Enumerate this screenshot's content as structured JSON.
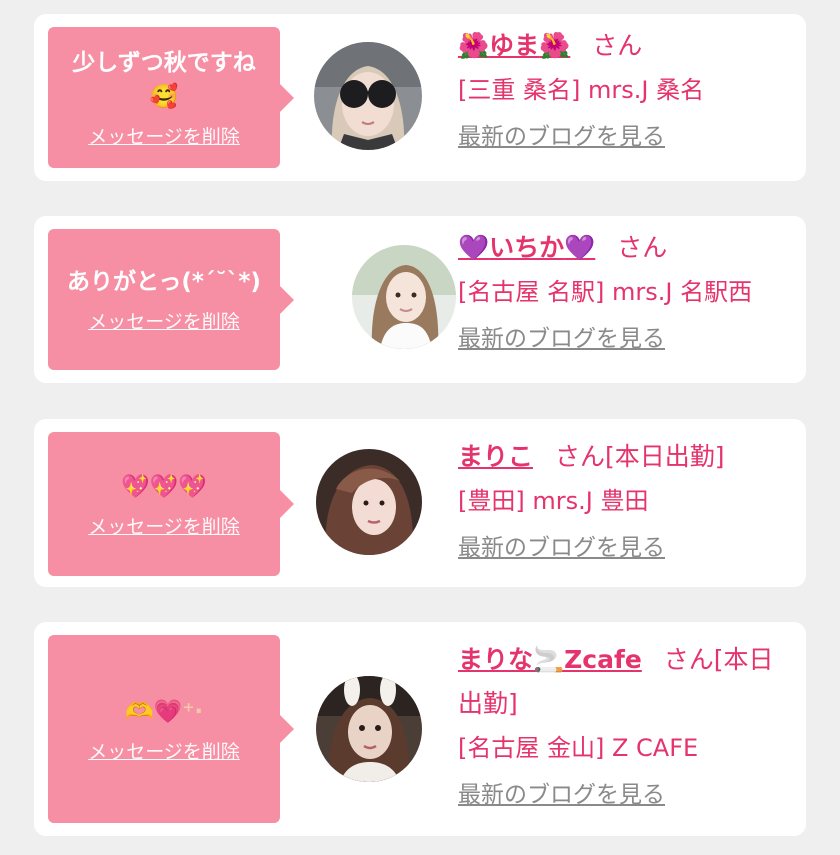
{
  "delete_label": "メッセージを削除",
  "blog_label": "最新のブログを見る",
  "honorific": "さん",
  "cards": [
    {
      "message": "少しずつ秋ですね",
      "message_emoji": "🥰",
      "name_prefix": "🌺",
      "name": "ゆま",
      "name_suffix": "🌺",
      "status": "",
      "shop": "[三重 桑名] mrs.J 桑名",
      "avatar_icon": "avatar-sunglasses-woman"
    },
    {
      "message": "ありがとっ(*´˘`*)",
      "message_emoji": "",
      "name_prefix": "💜",
      "name": "いちか",
      "name_suffix": "💜",
      "status": "",
      "shop": "[名古屋 名駅] mrs.J 名駅西",
      "avatar_icon": "avatar-woman-white-dress"
    },
    {
      "message": "",
      "message_emoji": "💖💖💖",
      "name_prefix": "",
      "name": "まりこ",
      "name_suffix": "",
      "status": "[本日出勤]",
      "shop": "[豊田] mrs.J 豊田",
      "avatar_icon": "avatar-woman-wavy-hair"
    },
    {
      "message": "",
      "message_emoji": "🫶💗⁺‧",
      "name_prefix": "",
      "name": "まりな🚬Zcafe",
      "name_suffix": "",
      "status": "[本日出勤]",
      "shop": "[名古屋 金山] Z CAFE",
      "avatar_icon": "avatar-woman-bunny-ears"
    }
  ]
}
